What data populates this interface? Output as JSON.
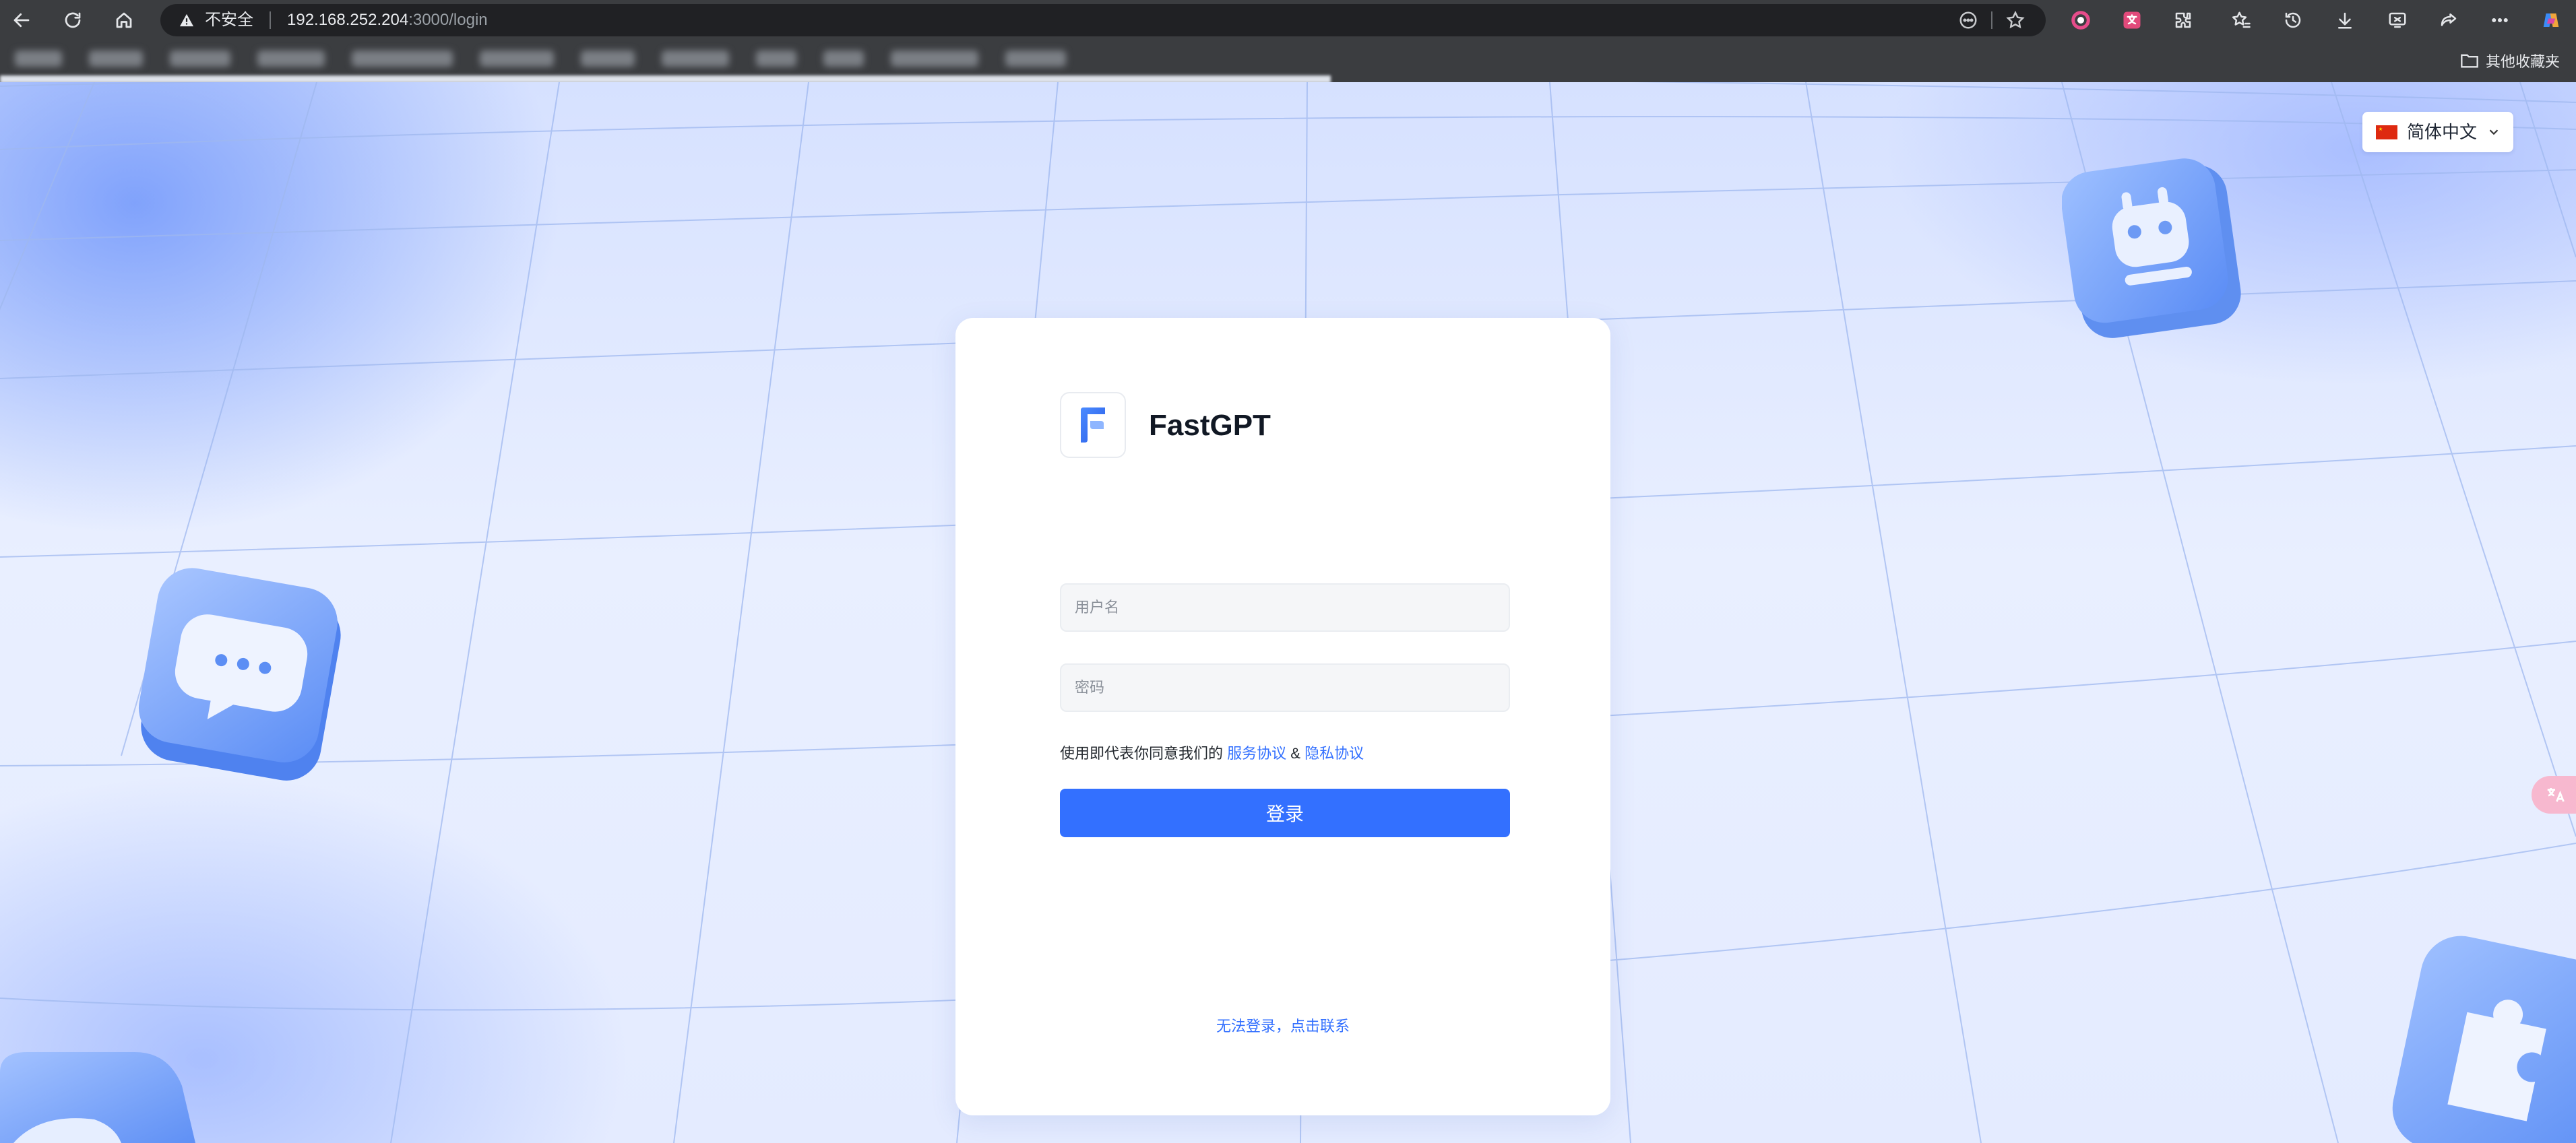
{
  "browser": {
    "security_label": "不安全",
    "url_host": "192.168.252.204",
    "url_path": ":3000/login",
    "other_bookmarks": "其他收藏夹"
  },
  "language": {
    "selected": "简体中文"
  },
  "login": {
    "brand": "FastGPT",
    "username_placeholder": "用户名",
    "password_placeholder": "密码",
    "agreement_prefix": "使用即代表你同意我们的",
    "terms_link": "服务协议",
    "agreement_and": "&",
    "privacy_link": "隐私协议",
    "login_button": "登录",
    "contact_link": "无法登录，点击联系"
  },
  "colors": {
    "primary": "#3370ff",
    "page_bg": "#e6edff",
    "card_bg": "#ffffff"
  }
}
